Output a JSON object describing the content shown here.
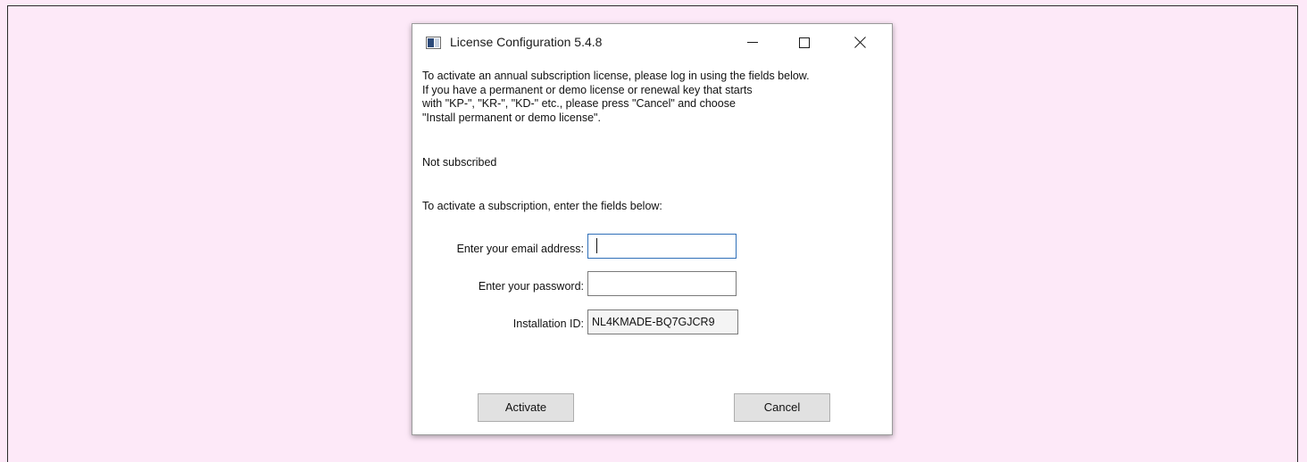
{
  "window": {
    "title": "License Configuration 5.4.8",
    "controls": {
      "minimize": "minimize-icon",
      "maximize": "maximize-icon",
      "close": "close-icon"
    }
  },
  "intro_text": "To activate an annual subscription license, please log in using the fields below.\nIf you have a permanent or demo license or renewal key that starts\nwith \"KP-\", \"KR-\", \"KD-\" etc., please press \"Cancel\" and choose\n\"Install permanent or demo license\".",
  "status_text": "Not subscribed",
  "prompt_text": "To activate a subscription, enter the fields below:",
  "form": {
    "email": {
      "label": "Enter your email address:",
      "value": ""
    },
    "password": {
      "label": "Enter your password:",
      "value": ""
    },
    "installation_id": {
      "label": "Installation ID:",
      "value": "NL4KMADE-BQ7GJCR9"
    }
  },
  "buttons": {
    "activate": "Activate",
    "cancel": "Cancel"
  },
  "colors": {
    "page_background": "#fde9f8",
    "focus_border": "#2f6fb8",
    "button_face": "#e1e1e1"
  }
}
